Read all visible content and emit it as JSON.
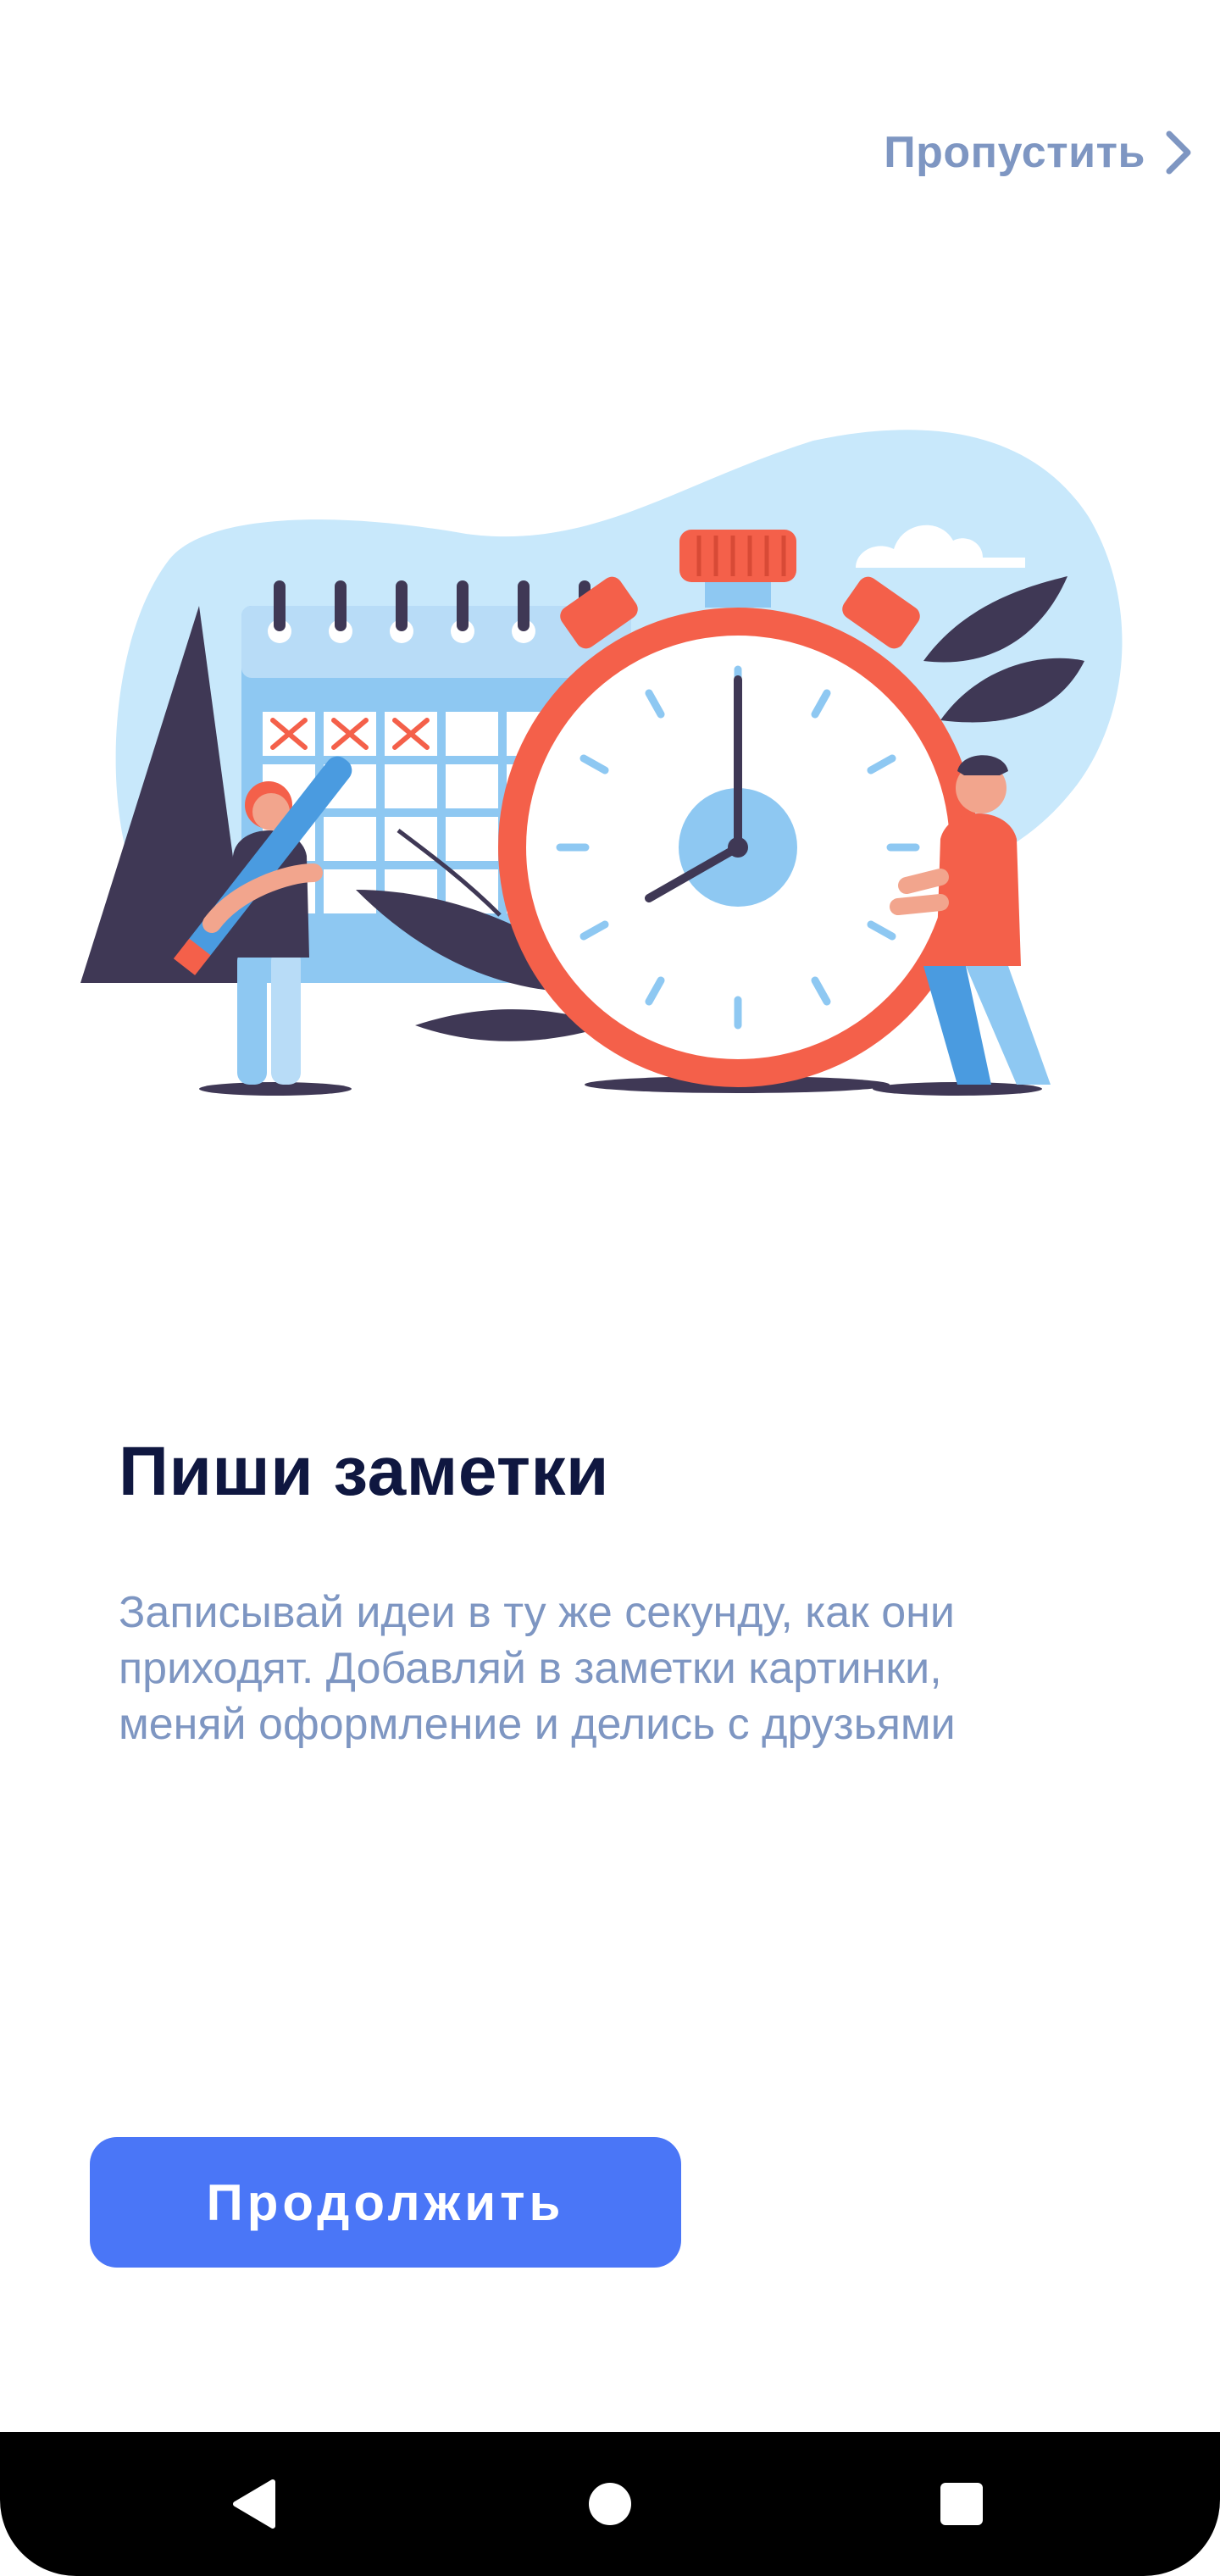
{
  "header": {
    "skip_label": "Пропустить",
    "skip_icon": "chevron-right-icon"
  },
  "illustration": {
    "subject": "calendar-stopwatch-illustration"
  },
  "onboarding": {
    "title": "Пиши заметки",
    "description": "Записывай идеи в ту же секунду, как они\nприходят. Добавляй в заметки картинки,\nменяй оформление и делись с друзьями"
  },
  "actions": {
    "continue_label": "Продолжить"
  },
  "system_nav": {
    "back_icon": "back-triangle-icon",
    "home_icon": "home-circle-icon",
    "recent_icon": "recent-apps-square-icon"
  },
  "colors": {
    "accent": "#4a76f7",
    "title": "#0f1740",
    "muted": "#7e96c2",
    "clock_red": "#f4604a",
    "sky_blue": "#c8e8fb"
  }
}
